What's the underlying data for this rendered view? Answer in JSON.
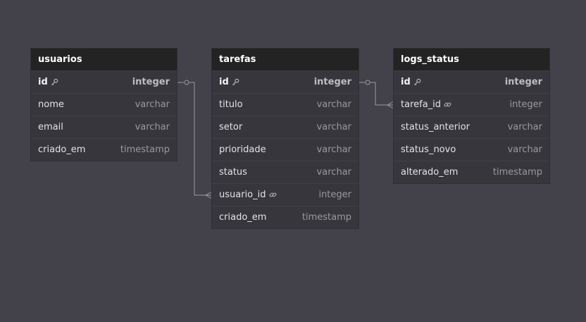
{
  "colors": {
    "canvas": "#43424a",
    "table_body": "#37363d",
    "table_header": "#232323",
    "connector": "#9a999f"
  },
  "tables": [
    {
      "name": "usuarios",
      "columns": [
        {
          "name": "id",
          "type": "integer",
          "pk": true,
          "icon": "key-icon"
        },
        {
          "name": "nome",
          "type": "varchar"
        },
        {
          "name": "email",
          "type": "varchar"
        },
        {
          "name": "criado_em",
          "type": "timestamp"
        }
      ]
    },
    {
      "name": "tarefas",
      "columns": [
        {
          "name": "id",
          "type": "integer",
          "pk": true,
          "icon": "key-icon"
        },
        {
          "name": "titulo",
          "type": "varchar"
        },
        {
          "name": "setor",
          "type": "varchar"
        },
        {
          "name": "prioridade",
          "type": "varchar"
        },
        {
          "name": "status",
          "type": "varchar"
        },
        {
          "name": "usuario_id",
          "type": "integer",
          "fk": true,
          "icon": "link-icon"
        },
        {
          "name": "criado_em",
          "type": "timestamp"
        }
      ]
    },
    {
      "name": "logs_status",
      "columns": [
        {
          "name": "id",
          "type": "integer",
          "pk": true,
          "icon": "key-icon"
        },
        {
          "name": "tarefa_id",
          "type": "integer",
          "fk": true,
          "icon": "link-icon"
        },
        {
          "name": "status_anterior",
          "type": "varchar"
        },
        {
          "name": "status_novo",
          "type": "varchar"
        },
        {
          "name": "alterado_em",
          "type": "timestamp"
        }
      ]
    }
  ],
  "relationships": [
    {
      "from": "usuarios.id",
      "to": "tarefas.usuario_id",
      "from_end": "one",
      "to_end": "many"
    },
    {
      "from": "tarefas.id",
      "to": "logs_status.tarefa_id",
      "from_end": "one",
      "to_end": "many"
    }
  ]
}
